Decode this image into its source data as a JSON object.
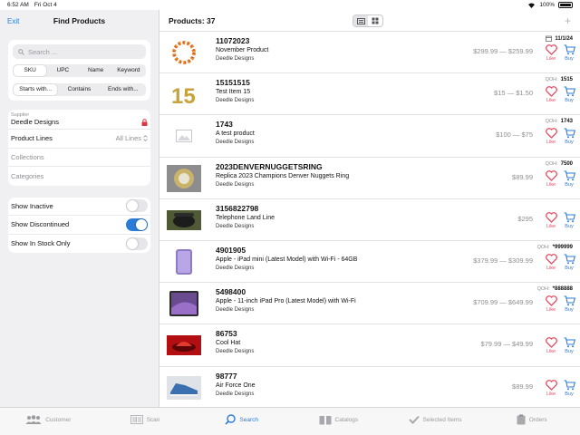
{
  "status": {
    "time": "6:52 AM",
    "date": "Fri Oct 4",
    "battery": "100%"
  },
  "sidebar": {
    "exit": "Exit",
    "title": "Find Products",
    "search_placeholder": "Search ...",
    "search_fields": [
      "SKU",
      "UPC",
      "Name",
      "Keyword"
    ],
    "match_modes": [
      "Starts with...",
      "Contains",
      "Ends with..."
    ],
    "supplier_label": "Supplier",
    "supplier_value": "Deedle Designs",
    "product_lines_label": "Product Lines",
    "product_lines_value": "All Lines",
    "collections": "Collections",
    "categories": "Categories",
    "show_inactive": "Show Inactive",
    "show_discontinued": "Show Discontinued",
    "show_in_stock": "Show In Stock Only"
  },
  "main": {
    "count_label": "Products: 37"
  },
  "labels": {
    "qoh": "QOH:",
    "like": "Like",
    "buy": "Buy"
  },
  "products": [
    {
      "sku": "11072023",
      "name": "November Product",
      "supplier": "Deedle Designs",
      "price": "$299.99 — $259.99",
      "qoh": "11/1/24",
      "qoh_is_date": true
    },
    {
      "sku": "15151515",
      "name": "Test Item 15",
      "supplier": "Deedle Designs",
      "price": "$15 — $1.50",
      "qoh": "1515"
    },
    {
      "sku": "1743",
      "name": "A test product",
      "supplier": "Deedle Designs",
      "price": "$100 — $75",
      "qoh": "1743"
    },
    {
      "sku": "2023DENVERNUGGETSRING",
      "name": "Replica 2023 Champions Denver Nuggets Ring",
      "supplier": "Deedle Designs",
      "price": "$89.99",
      "qoh": "7500"
    },
    {
      "sku": "3156822798",
      "name": "Telephone Land Line",
      "supplier": "Deedle Designs",
      "price": "$295",
      "qoh": ""
    },
    {
      "sku": "4901905",
      "name": "Apple - iPad mini (Latest Model) with Wi-Fi - 64GB",
      "supplier": "Deedle Designs",
      "price": "$379.99 — $309.99",
      "qoh": "*999999"
    },
    {
      "sku": "5498400",
      "name": "Apple - 11-inch iPad Pro (Latest Model) with Wi-Fi",
      "supplier": "Deedle Designs",
      "price": "$709.99 — $649.99",
      "qoh": "*888888"
    },
    {
      "sku": "86753",
      "name": "Cool Hat",
      "supplier": "Deedle Designs",
      "price": "$79.99 — $49.99",
      "qoh": ""
    },
    {
      "sku": "98777",
      "name": "Air Force One",
      "supplier": "Deedle Designs",
      "price": "$89.99",
      "qoh": ""
    }
  ],
  "tabs": [
    "Customer",
    "Scan",
    "Search",
    "Catalogs",
    "Selected Items",
    "Orders"
  ],
  "colors": {
    "accent": "#2a7cd7",
    "like": "#e84a5f",
    "toggle_on": "#2a7cd7"
  }
}
